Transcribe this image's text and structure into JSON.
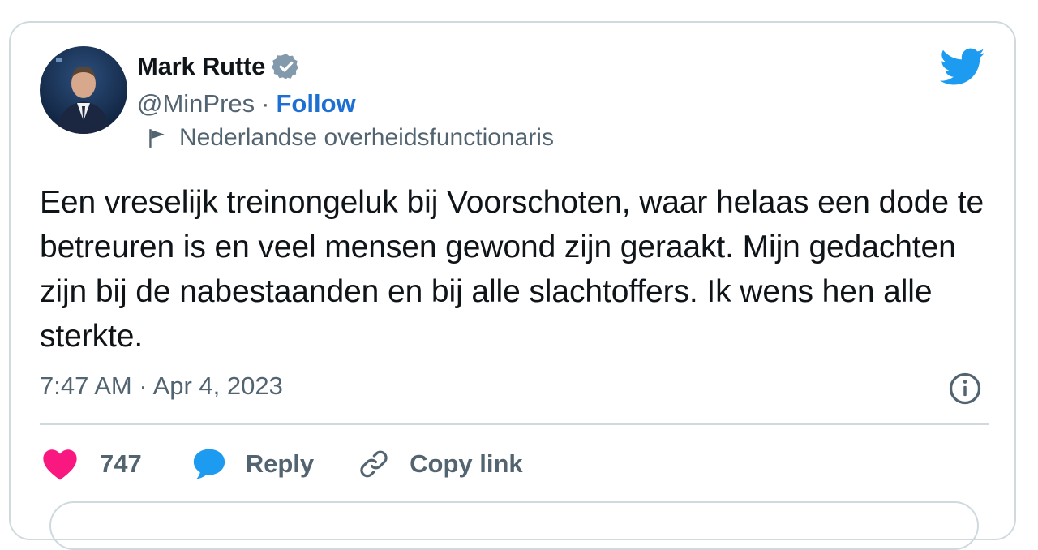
{
  "author": {
    "name": "Mark Rutte",
    "handle": "@MinPres",
    "separator": "·",
    "follow_label": "Follow",
    "label_text": "Nederlandse overheidsfunctionaris",
    "avatar_icon": "profile-photo",
    "verified_icon": "verified-badge-icon",
    "label_icon": "flag-icon"
  },
  "brand": {
    "icon": "twitter-bird-icon",
    "color": "#1d9bf0"
  },
  "tweet": {
    "text": "Een vreselijk treinongeluk bij Voorschoten, waar helaas een dode te betreuren is en veel mensen gewond zijn geraakt. Mijn gedachten zijn bij de nabestaanden en bij alle slachtoffers. Ik wens hen alle sterkte.",
    "timestamp": "7:47 AM · Apr 4, 2023",
    "info_icon": "info-icon"
  },
  "actions": {
    "like_count": "747",
    "like_icon": "heart-icon",
    "like_color": "#f91880",
    "reply_label": "Reply",
    "reply_icon": "speech-bubble-icon",
    "reply_color": "#1d9bf0",
    "copy_label": "Copy link",
    "copy_icon": "link-icon"
  }
}
